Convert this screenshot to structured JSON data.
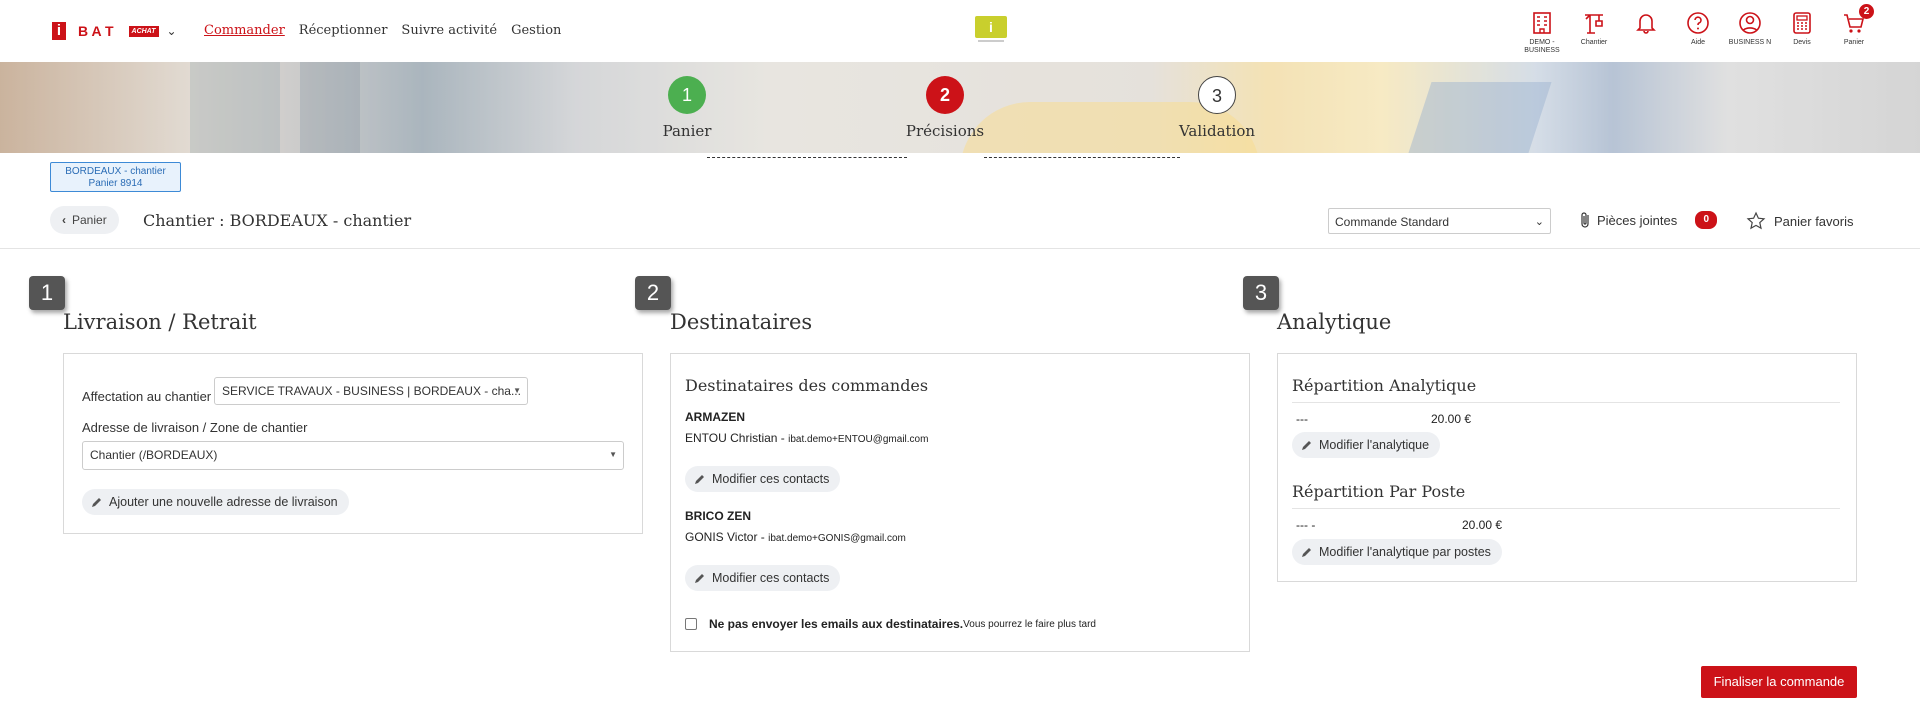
{
  "header": {
    "logo_i": "i",
    "logo_letters": "B A T",
    "logo_tag": "ACHAT",
    "nav": [
      "Commander",
      "Réceptionner",
      "Suivre activité",
      "Gestion"
    ],
    "info_label": "i",
    "tools": [
      {
        "icon": "building-icon",
        "label": "DEMO - BUSINESS"
      },
      {
        "icon": "crane-icon",
        "label": "Chantier"
      },
      {
        "icon": "bell-icon",
        "label": ""
      },
      {
        "icon": "help-icon",
        "label": "Aide"
      },
      {
        "icon": "user-icon",
        "label": "BUSINESS N"
      },
      {
        "icon": "calculator-icon",
        "label": "Devis"
      },
      {
        "icon": "cart-icon",
        "label": "Panier",
        "badge": "2"
      }
    ],
    "accent_color": "#cc1218"
  },
  "stepper": {
    "steps": [
      {
        "num": "1",
        "label": "Panier",
        "state": "done",
        "color": "#4caf50"
      },
      {
        "num": "2",
        "label": "Précisions",
        "state": "active",
        "color": "#cc1218"
      },
      {
        "num": "3",
        "label": "Validation",
        "state": "todo",
        "color": "#ffffff"
      }
    ]
  },
  "tag": {
    "line1": "BORDEAUX - chantier",
    "line2": "Panier 8914"
  },
  "subheader": {
    "back_label": "Panier",
    "title": "Chantier : BORDEAUX - chantier",
    "order_type": "Commande Standard",
    "attachments_label": "Pièces jointes",
    "attachments_count": "0",
    "favorites_label": "Panier favoris"
  },
  "section1": {
    "num": "1",
    "title": "Livraison / Retrait",
    "affectation_label": "Affectation au chantier",
    "affectation_value": "SERVICE TRAVAUX - BUSINESS | BORDEAUX - cha...",
    "address_label": "Adresse de livraison / Zone de chantier",
    "address_value": "Chantier (/BORDEAUX)",
    "add_address_button": "Ajouter une nouvelle adresse de livraison"
  },
  "section2": {
    "num": "2",
    "title": "Destinataires",
    "subtitle": "Destinataires des commandes",
    "recipients": [
      {
        "company": "ARMAZEN",
        "contact": "ENTOU Christian - ",
        "email": "ibat.demo+ENTOU@gmail.com",
        "button": "Modifier ces contacts"
      },
      {
        "company": "BRICO ZEN",
        "contact": "GONIS Victor - ",
        "email": "ibat.demo+GONIS@gmail.com",
        "button": "Modifier ces contacts"
      }
    ],
    "no_email_label": "Ne pas envoyer les emails aux destinataires.",
    "no_email_hint": "Vous pourrez le faire plus tard"
  },
  "section3": {
    "num": "3",
    "title": "Analytique",
    "analytic_title": "Répartition Analytique",
    "analytic_row_label": "---",
    "analytic_row_value": "20.00 €",
    "analytic_button": "Modifier l'analytique",
    "poste_title": "Répartition Par Poste",
    "poste_row_label": "--- -",
    "poste_row_value": "20.00 €",
    "poste_button": "Modifier l'analytique par postes"
  },
  "footer": {
    "finalize_button": "Finaliser la commande"
  }
}
